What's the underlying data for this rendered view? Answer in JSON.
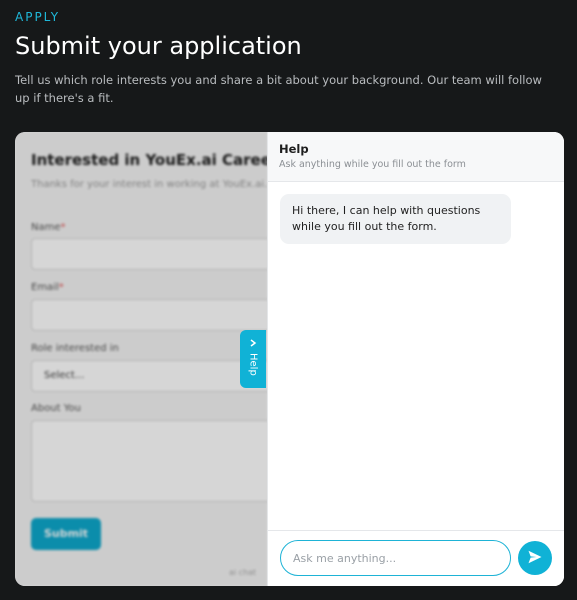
{
  "page": {
    "eyebrow": "APPLY",
    "title": "Submit your application",
    "intro": "Tell us which role interests you and share a bit about your background. Our team will follow up if there's a fit."
  },
  "form": {
    "title": "Interested in YouEx.ai Careers?",
    "intro": "Thanks for your interest in working at YouEx.ai. In the meantime, feel free to ask the help assistant.",
    "name_label": "Name",
    "email_label": "Email",
    "role_label": "Role interested in",
    "role_selected": "Select...",
    "about_label": "About You",
    "submit_label": "Submit",
    "required_mark": "*",
    "footer": "ai chat"
  },
  "help_tab": {
    "label": "Help",
    "icon": "chevron-right-icon"
  },
  "help_panel": {
    "title": "Help",
    "subtitle": "Ask anything while you fill out the form",
    "messages": [
      {
        "from": "assistant",
        "text": "Hi there, I can help with questions while you fill out the form."
      }
    ],
    "input_placeholder": "Ask me anything...",
    "send_icon": "send-icon"
  },
  "colors": {
    "accent": "#10b2d6",
    "background": "#161819"
  }
}
